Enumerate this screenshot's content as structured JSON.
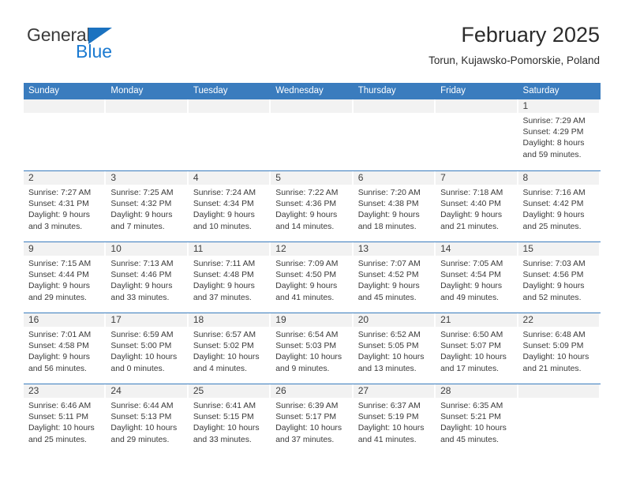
{
  "brand": {
    "name_part1": "General",
    "name_part2": "Blue",
    "triangle_color": "#1b72c0",
    "blue_text_color": "#1b7ad1"
  },
  "header": {
    "title": "February 2025",
    "subtitle": "Torun, Kujawsko-Pomorskie, Poland"
  },
  "theme": {
    "header_row_bg": "#3a7cbe",
    "day_band_bg": "#f2f2f2",
    "week_divider": "#3a7cbe",
    "text_color": "#3a3a3a"
  },
  "weekdays": [
    "Sunday",
    "Monday",
    "Tuesday",
    "Wednesday",
    "Thursday",
    "Friday",
    "Saturday"
  ],
  "labels": {
    "sunrise_prefix": "Sunrise:",
    "sunset_prefix": "Sunset:",
    "daylight_prefix": "Daylight:"
  },
  "weeks": [
    [
      {
        "day": "",
        "sunrise": "",
        "sunset": "",
        "daylight": "",
        "empty": true
      },
      {
        "day": "",
        "sunrise": "",
        "sunset": "",
        "daylight": "",
        "empty": true
      },
      {
        "day": "",
        "sunrise": "",
        "sunset": "",
        "daylight": "",
        "empty": true
      },
      {
        "day": "",
        "sunrise": "",
        "sunset": "",
        "daylight": "",
        "empty": true
      },
      {
        "day": "",
        "sunrise": "",
        "sunset": "",
        "daylight": "",
        "empty": true
      },
      {
        "day": "",
        "sunrise": "",
        "sunset": "",
        "daylight": "",
        "empty": true
      },
      {
        "day": "1",
        "sunrise": "Sunrise: 7:29 AM",
        "sunset": "Sunset: 4:29 PM",
        "daylight": "Daylight: 8 hours and 59 minutes.",
        "empty": false
      }
    ],
    [
      {
        "day": "2",
        "sunrise": "Sunrise: 7:27 AM",
        "sunset": "Sunset: 4:31 PM",
        "daylight": "Daylight: 9 hours and 3 minutes.",
        "empty": false
      },
      {
        "day": "3",
        "sunrise": "Sunrise: 7:25 AM",
        "sunset": "Sunset: 4:32 PM",
        "daylight": "Daylight: 9 hours and 7 minutes.",
        "empty": false
      },
      {
        "day": "4",
        "sunrise": "Sunrise: 7:24 AM",
        "sunset": "Sunset: 4:34 PM",
        "daylight": "Daylight: 9 hours and 10 minutes.",
        "empty": false
      },
      {
        "day": "5",
        "sunrise": "Sunrise: 7:22 AM",
        "sunset": "Sunset: 4:36 PM",
        "daylight": "Daylight: 9 hours and 14 minutes.",
        "empty": false
      },
      {
        "day": "6",
        "sunrise": "Sunrise: 7:20 AM",
        "sunset": "Sunset: 4:38 PM",
        "daylight": "Daylight: 9 hours and 18 minutes.",
        "empty": false
      },
      {
        "day": "7",
        "sunrise": "Sunrise: 7:18 AM",
        "sunset": "Sunset: 4:40 PM",
        "daylight": "Daylight: 9 hours and 21 minutes.",
        "empty": false
      },
      {
        "day": "8",
        "sunrise": "Sunrise: 7:16 AM",
        "sunset": "Sunset: 4:42 PM",
        "daylight": "Daylight: 9 hours and 25 minutes.",
        "empty": false
      }
    ],
    [
      {
        "day": "9",
        "sunrise": "Sunrise: 7:15 AM",
        "sunset": "Sunset: 4:44 PM",
        "daylight": "Daylight: 9 hours and 29 minutes.",
        "empty": false
      },
      {
        "day": "10",
        "sunrise": "Sunrise: 7:13 AM",
        "sunset": "Sunset: 4:46 PM",
        "daylight": "Daylight: 9 hours and 33 minutes.",
        "empty": false
      },
      {
        "day": "11",
        "sunrise": "Sunrise: 7:11 AM",
        "sunset": "Sunset: 4:48 PM",
        "daylight": "Daylight: 9 hours and 37 minutes.",
        "empty": false
      },
      {
        "day": "12",
        "sunrise": "Sunrise: 7:09 AM",
        "sunset": "Sunset: 4:50 PM",
        "daylight": "Daylight: 9 hours and 41 minutes.",
        "empty": false
      },
      {
        "day": "13",
        "sunrise": "Sunrise: 7:07 AM",
        "sunset": "Sunset: 4:52 PM",
        "daylight": "Daylight: 9 hours and 45 minutes.",
        "empty": false
      },
      {
        "day": "14",
        "sunrise": "Sunrise: 7:05 AM",
        "sunset": "Sunset: 4:54 PM",
        "daylight": "Daylight: 9 hours and 49 minutes.",
        "empty": false
      },
      {
        "day": "15",
        "sunrise": "Sunrise: 7:03 AM",
        "sunset": "Sunset: 4:56 PM",
        "daylight": "Daylight: 9 hours and 52 minutes.",
        "empty": false
      }
    ],
    [
      {
        "day": "16",
        "sunrise": "Sunrise: 7:01 AM",
        "sunset": "Sunset: 4:58 PM",
        "daylight": "Daylight: 9 hours and 56 minutes.",
        "empty": false
      },
      {
        "day": "17",
        "sunrise": "Sunrise: 6:59 AM",
        "sunset": "Sunset: 5:00 PM",
        "daylight": "Daylight: 10 hours and 0 minutes.",
        "empty": false
      },
      {
        "day": "18",
        "sunrise": "Sunrise: 6:57 AM",
        "sunset": "Sunset: 5:02 PM",
        "daylight": "Daylight: 10 hours and 4 minutes.",
        "empty": false
      },
      {
        "day": "19",
        "sunrise": "Sunrise: 6:54 AM",
        "sunset": "Sunset: 5:03 PM",
        "daylight": "Daylight: 10 hours and 9 minutes.",
        "empty": false
      },
      {
        "day": "20",
        "sunrise": "Sunrise: 6:52 AM",
        "sunset": "Sunset: 5:05 PM",
        "daylight": "Daylight: 10 hours and 13 minutes.",
        "empty": false
      },
      {
        "day": "21",
        "sunrise": "Sunrise: 6:50 AM",
        "sunset": "Sunset: 5:07 PM",
        "daylight": "Daylight: 10 hours and 17 minutes.",
        "empty": false
      },
      {
        "day": "22",
        "sunrise": "Sunrise: 6:48 AM",
        "sunset": "Sunset: 5:09 PM",
        "daylight": "Daylight: 10 hours and 21 minutes.",
        "empty": false
      }
    ],
    [
      {
        "day": "23",
        "sunrise": "Sunrise: 6:46 AM",
        "sunset": "Sunset: 5:11 PM",
        "daylight": "Daylight: 10 hours and 25 minutes.",
        "empty": false
      },
      {
        "day": "24",
        "sunrise": "Sunrise: 6:44 AM",
        "sunset": "Sunset: 5:13 PM",
        "daylight": "Daylight: 10 hours and 29 minutes.",
        "empty": false
      },
      {
        "day": "25",
        "sunrise": "Sunrise: 6:41 AM",
        "sunset": "Sunset: 5:15 PM",
        "daylight": "Daylight: 10 hours and 33 minutes.",
        "empty": false
      },
      {
        "day": "26",
        "sunrise": "Sunrise: 6:39 AM",
        "sunset": "Sunset: 5:17 PM",
        "daylight": "Daylight: 10 hours and 37 minutes.",
        "empty": false
      },
      {
        "day": "27",
        "sunrise": "Sunrise: 6:37 AM",
        "sunset": "Sunset: 5:19 PM",
        "daylight": "Daylight: 10 hours and 41 minutes.",
        "empty": false
      },
      {
        "day": "28",
        "sunrise": "Sunrise: 6:35 AM",
        "sunset": "Sunset: 5:21 PM",
        "daylight": "Daylight: 10 hours and 45 minutes.",
        "empty": false
      },
      {
        "day": "",
        "sunrise": "",
        "sunset": "",
        "daylight": "",
        "empty": true
      }
    ]
  ]
}
